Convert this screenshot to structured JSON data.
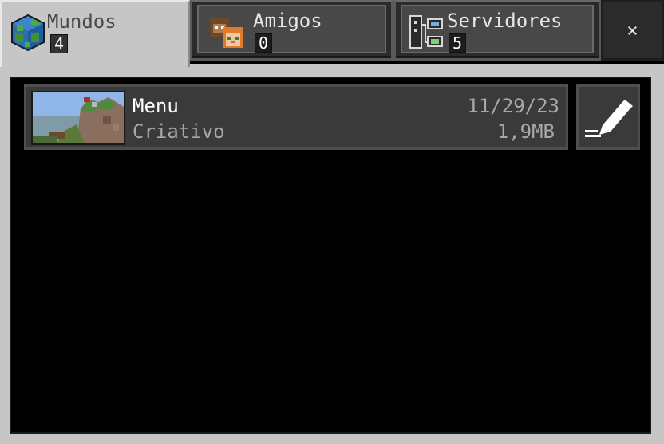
{
  "tabs": {
    "worlds": {
      "label": "Mundos",
      "count": "4",
      "icon": "globe-icon"
    },
    "friends": {
      "label": "Amigos",
      "count": "0",
      "icon": "friends-icon"
    },
    "servers": {
      "label": "Servidores",
      "count": "5",
      "icon": "server-icon"
    },
    "close": {
      "label": "×",
      "icon": "close-icon"
    }
  },
  "worlds_list": [
    {
      "name": "Menu",
      "mode": "Criativo",
      "date": "11/29/23",
      "size": "1,9MB",
      "thumbnail": "world-thumbnail",
      "edit_icon": "pencil-icon"
    }
  ],
  "colors": {
    "panel_gray": "#c6c6c6",
    "tab_dark": "#2b2b2b",
    "row_bg": "#3a3a3a",
    "text_white": "#ffffff",
    "text_gray": "#a8a8a8"
  }
}
